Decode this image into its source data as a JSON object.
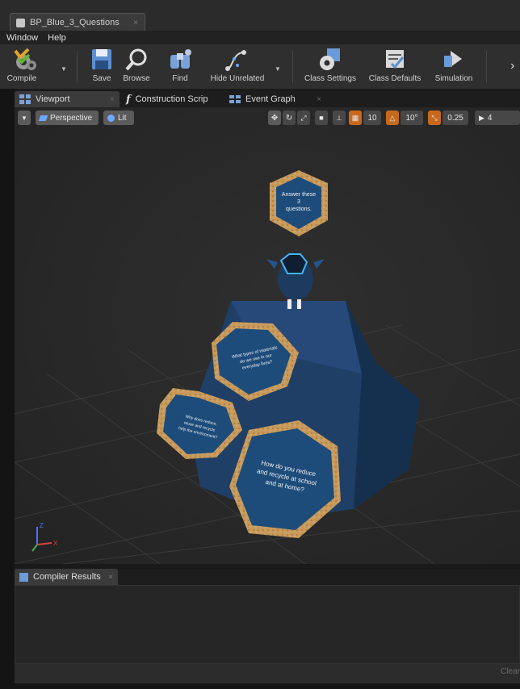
{
  "window": {
    "tab_title": "BP_Blue_3_Questions",
    "tab_close": "×"
  },
  "menu": {
    "items": [
      "Window",
      "Help"
    ]
  },
  "toolbar": {
    "compile": "Compile",
    "save": "Save",
    "browse": "Browse",
    "find": "Find",
    "hide_unrelated": "Hide Unrelated",
    "class_settings": "Class Settings",
    "class_defaults": "Class Defaults",
    "simulation": "Simulation",
    "overflow": "›"
  },
  "editor_tabs": [
    {
      "label": "Viewport",
      "close": "×"
    },
    {
      "label": "Construction Scrip",
      "close": "×"
    },
    {
      "label": "Event Graph",
      "close": "×"
    }
  ],
  "viewport": {
    "view_mode": "Perspective",
    "lighting": "Lit",
    "grid_size": "10",
    "rotation_snap": "10°",
    "scale_snap": "0.25",
    "camera_speed": "4",
    "signs": {
      "top": [
        "Answer these",
        "3",
        "questions."
      ],
      "middle": [
        "What types of materials",
        "do we use in our",
        "everyday lives?"
      ],
      "left": [
        "Why does reduce,",
        "reuse and recycle",
        "help the environment?"
      ],
      "front": [
        "How do you reduce",
        "and recycle at school",
        "and at home?"
      ]
    },
    "axis_label_x": "X",
    "axis_label_z": "Z",
    "colors": {
      "board_blue": "#1d4c7a",
      "cork": "#c89a5a",
      "rock_blue": "#1f3f67",
      "accent_orange": "#c7691d"
    }
  },
  "results": {
    "tab_label": "Compiler Results",
    "tab_close": "×",
    "clear": "Clear"
  }
}
